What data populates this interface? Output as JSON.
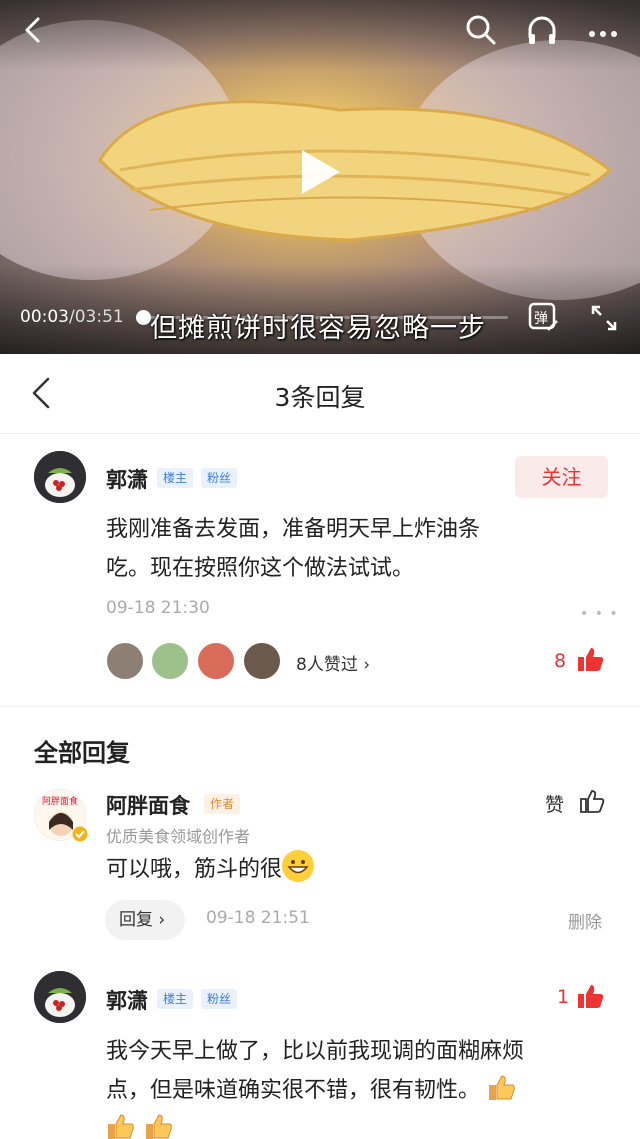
{
  "video": {
    "current_time": "00:03",
    "total_time": "/03:51",
    "progress": 0.013,
    "subtitle": "但摊煎饼时很容易忽略一步"
  },
  "header": {
    "title": "3条回复"
  },
  "main_comment": {
    "user": "郭潇",
    "tags": [
      "楼主",
      "粉丝"
    ],
    "follow_label": "关注",
    "text_line1": "我刚准备去发面，准备明天早上炸油条",
    "text_line2": "吃。现在按照你这个做法试试。",
    "time": "09-18 21:30",
    "likers_text": "8人赞过",
    "like_count": "8"
  },
  "section_title": "全部回复",
  "replies": [
    {
      "user": "阿胖面食",
      "tag": "作者",
      "subtitle": "优质美食领域创作者",
      "avatar_text": "阿胖面食",
      "text": "可以哦，筋斗的很",
      "reply_label": "回复",
      "time": "09-18 21:51",
      "like_label": "赞",
      "delete_label": "删除"
    },
    {
      "user": "郭潇",
      "tags": [
        "楼主",
        "粉丝"
      ],
      "text_line1": "我今天早上做了，比以前我现调的面糊麻烦",
      "text_line2": "点，但是味道确实很不错，很有韧性。",
      "like_count": "1"
    }
  ],
  "colors": {
    "accent_red": "#e33333",
    "tag_blue": "#3d7ee0",
    "tag_orange": "#e08a3a"
  }
}
